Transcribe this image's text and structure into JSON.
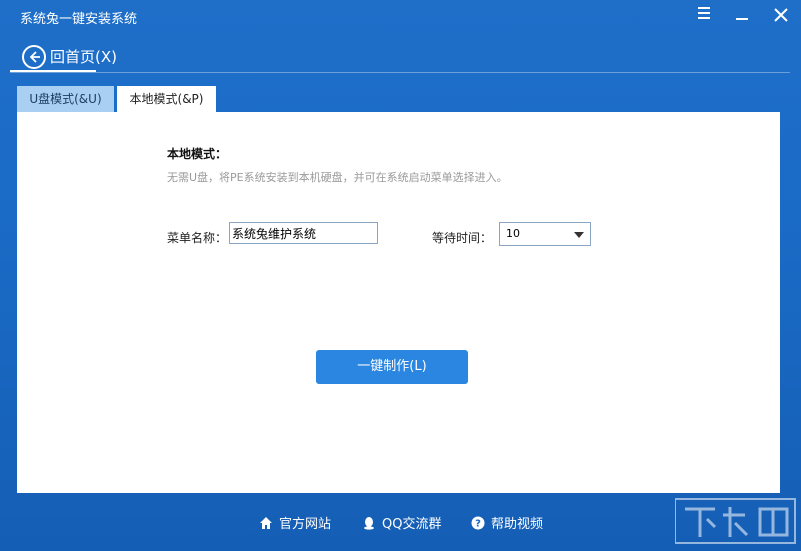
{
  "window": {
    "title": "系统兔一键安装系统",
    "controls": [
      "menu-icon",
      "minimize-icon",
      "close-icon"
    ]
  },
  "nav": {
    "back_label": "回首页(X)"
  },
  "tabs": [
    {
      "label": "U盘模式(&U)",
      "active": false
    },
    {
      "label": "本地模式(&P)",
      "active": true
    }
  ],
  "local_mode": {
    "title": "本地模式：",
    "description": "无需U盘，将PE系统安装到本机硬盘，并可在系统启动菜单选择进入。",
    "menu_name_label": "菜单名称：",
    "menu_name_value": "系统兔维护系统",
    "wait_time_label": "等待时间：",
    "wait_time_value": "10",
    "make_button": "一键制作(L)"
  },
  "footer": {
    "links": [
      {
        "label": "官方网站",
        "icon": "home-icon"
      },
      {
        "label": "QQ交流群",
        "icon": "qq-penguin-icon"
      },
      {
        "label": "帮助视频",
        "icon": "question-icon"
      }
    ]
  },
  "colors": {
    "background": "#1f6fc9",
    "tab_inactive": "#a9d0f2",
    "button": "#2a86e0"
  }
}
